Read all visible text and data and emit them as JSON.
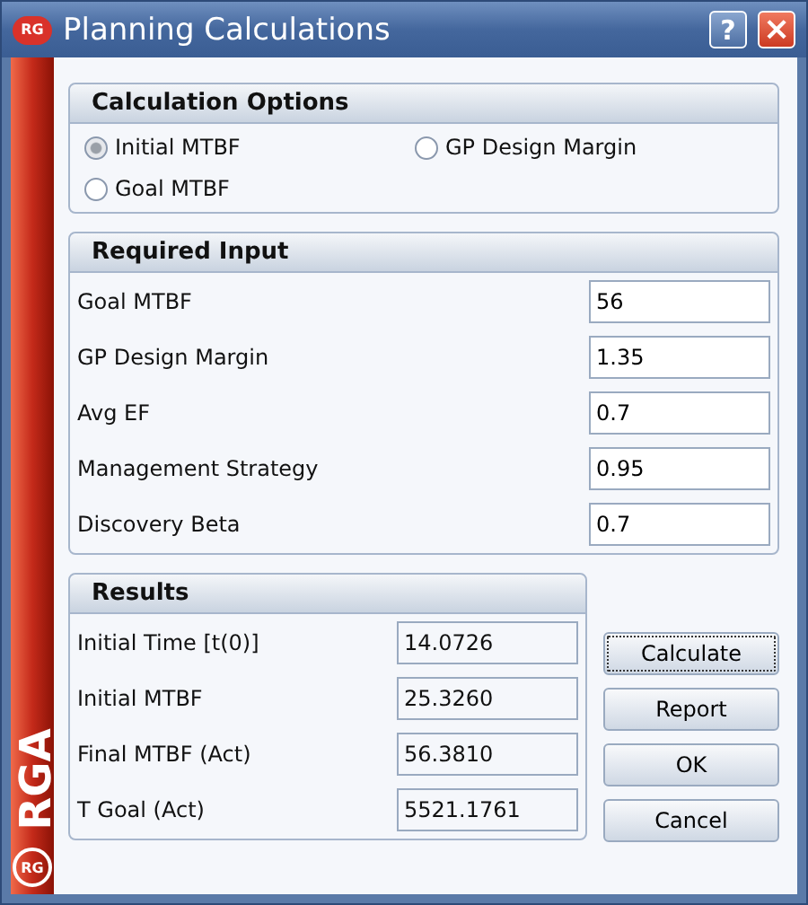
{
  "window": {
    "title": "Planning Calculations",
    "logo": "RG",
    "help": "?",
    "close": "×"
  },
  "sidebar": {
    "brand": "RGA",
    "logo": "RG"
  },
  "calculation_options": {
    "title": "Calculation Options",
    "options": [
      {
        "label": "Initial MTBF",
        "selected": true
      },
      {
        "label": "GP Design Margin",
        "selected": false
      },
      {
        "label": "Goal MTBF",
        "selected": false
      }
    ]
  },
  "required_input": {
    "title": "Required Input",
    "fields": [
      {
        "label": "Goal MTBF",
        "value": "56"
      },
      {
        "label": "GP Design Margin",
        "value": "1.35"
      },
      {
        "label": "Avg EF",
        "value": "0.7"
      },
      {
        "label": "Management Strategy",
        "value": "0.95"
      },
      {
        "label": "Discovery Beta",
        "value": "0.7"
      }
    ]
  },
  "results": {
    "title": "Results",
    "fields": [
      {
        "label": "Initial Time [t(0)]",
        "value": "14.0726"
      },
      {
        "label": "Initial MTBF",
        "value": "25.3260"
      },
      {
        "label": "Final MTBF (Act)",
        "value": "56.3810"
      },
      {
        "label": "T Goal (Act)",
        "value": "5521.1761"
      }
    ]
  },
  "buttons": [
    {
      "label": "Calculate",
      "focused": true
    },
    {
      "label": "Report",
      "focused": false
    },
    {
      "label": "OK",
      "focused": false
    },
    {
      "label": "Cancel",
      "focused": false
    }
  ]
}
